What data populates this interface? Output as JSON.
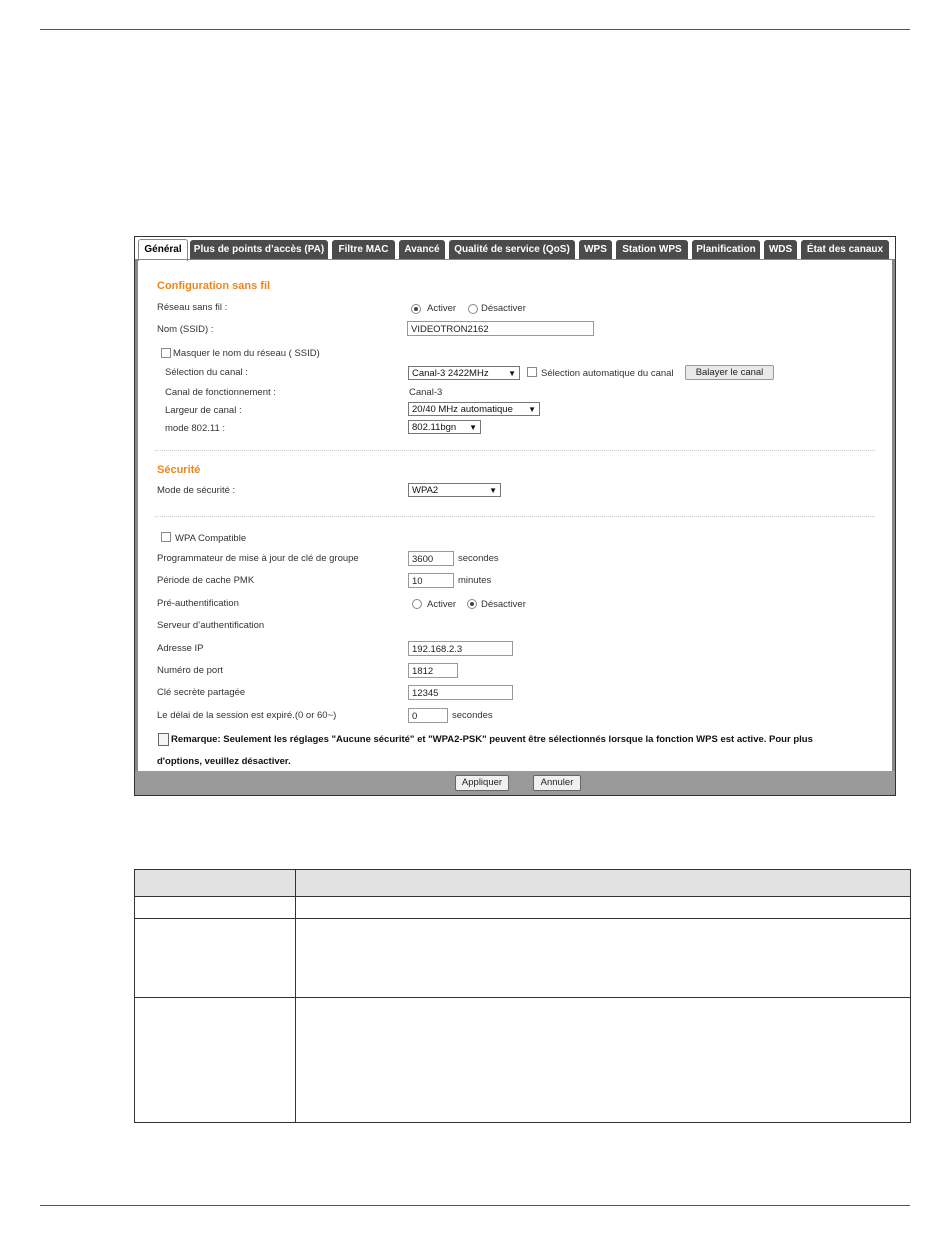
{
  "tabs": [
    {
      "label": "Général",
      "active": true
    },
    {
      "label": "Plus de points d’accès (PA)",
      "active": false
    },
    {
      "label": "Filtre MAC",
      "active": false
    },
    {
      "label": "Avancé",
      "active": false
    },
    {
      "label": "Qualité de service (QoS)",
      "active": false
    },
    {
      "label": "WPS",
      "active": false
    },
    {
      "label": "Station WPS",
      "active": false
    },
    {
      "label": "Planification",
      "active": false
    },
    {
      "label": "WDS",
      "active": false
    },
    {
      "label": "État des canaux",
      "active": false
    }
  ],
  "wireless_config": {
    "title": "Configuration sans fil",
    "network_label": "Réseau sans fil :",
    "enable_label": "Activer",
    "disable_label": "Désactiver",
    "network_enabled": true,
    "ssid_label": "Nom (SSID) :",
    "ssid_value": "VIDEOTRON2162",
    "hide_ssid_label": "Masquer le nom du réseau ( SSID)",
    "hide_ssid_checked": false,
    "channel_label": "Sélection du canal :",
    "channel_value": "Canal-3 2422MHz",
    "auto_channel_label": "Sélection automatique du canal",
    "auto_channel_checked": false,
    "scan_button": "Balayer le canal",
    "operating_channel_label": "Canal de fonctionnement :",
    "operating_channel_value": "Canal-3",
    "bandwidth_label": "Largeur de canal :",
    "bandwidth_value": "20/40 MHz automatique",
    "mode_label": "mode 802.11 :",
    "mode_value": "802.11bgn"
  },
  "security": {
    "title": "Sécurité",
    "mode_label": "Mode de sécurité :",
    "mode_value": "WPA2",
    "wpa_compatible_label": "WPA Compatible",
    "wpa_compatible_checked": false,
    "group_key_label": "Programmateur de mise à jour de clé de groupe",
    "group_key_value": "3600",
    "group_key_unit": "secondes",
    "pmk_label": "Période de cache PMK",
    "pmk_value": "10",
    "pmk_unit": "minutes",
    "preauth_label": "Pré-authentification",
    "preauth_enable": "Activer",
    "preauth_disable": "Désactiver",
    "preauth_enabled": false,
    "auth_server_label": "Serveur d’authentification",
    "ip_label": "Adresse IP",
    "ip_value": "192.168.2.3",
    "port_label": "Numéro de port",
    "port_value": "1812",
    "secret_label": "Clé secrète partagée",
    "secret_value": "12345",
    "session_label": "Le délai de la session est expiré.(0 or 60~)",
    "session_value": "0",
    "session_unit": "secondes"
  },
  "note": {
    "line1": "Remarque: Seulement les réglages \"Aucune sécurité\" et \"WPA2-PSK\" peuvent être sélectionnés lorsque la fonction WPS est active. Pour plus",
    "line2": "d'options, veuillez désactiver."
  },
  "footer": {
    "apply_button": "Appliquer",
    "cancel_button": "Annuler"
  }
}
